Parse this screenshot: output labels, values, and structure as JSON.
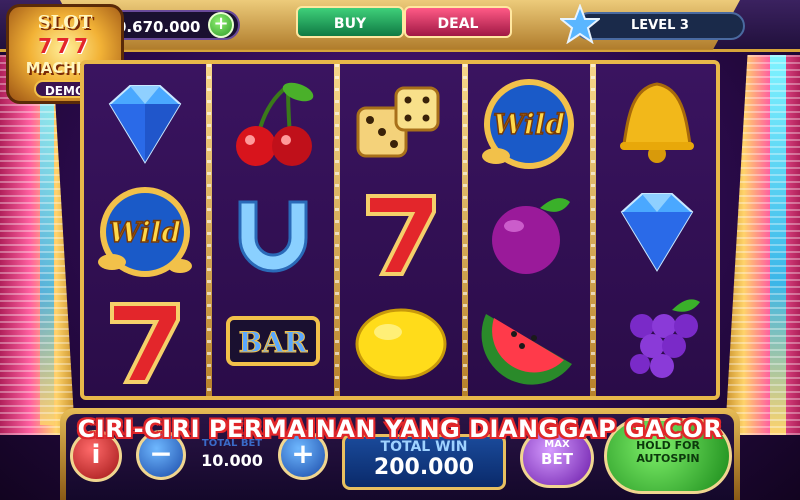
{
  "logo": {
    "line1": "SLOT",
    "line2": "777",
    "line3": "MACHINE",
    "badge": "DEMO"
  },
  "topbar": {
    "balance": "0.670.000",
    "add_button": "+",
    "tabs": [
      {
        "label": "BUY"
      },
      {
        "label": "DEAL"
      }
    ],
    "level": "LEVEL 3"
  },
  "reels": {
    "columns": [
      [
        "diamond-icon",
        "wild-icon",
        "seven-icon"
      ],
      [
        "cherries-icon",
        "horseshoe-icon",
        "bar-icon"
      ],
      [
        "dice-icon",
        "seven-icon",
        "lemon-icon"
      ],
      [
        "wild-icon",
        "plum-icon",
        "watermelon-icon"
      ],
      [
        "bell-icon",
        "diamond-icon",
        "grapes-icon"
      ]
    ],
    "wild_text": "Wild",
    "bar_text": "BAR"
  },
  "controls": {
    "info_label": "i",
    "minus_label": "−",
    "plus_label": "+",
    "total_bet_label": "TOTAL BET",
    "total_bet_value": "10.000",
    "total_win_label": "TOTAL WIN",
    "total_win_value": "200.000",
    "max_bet_top": "MAX",
    "max_bet_label": "BET",
    "hold_line1": "HOLD FOR",
    "hold_line2": "AUTOSPIN"
  },
  "caption": "CIRI-CIRI PERMAINAN YANG DIANGGAP GACOR",
  "colors": {
    "gold": "#e8b84a",
    "purple": "#2a0c48",
    "caption_outline": "#e0262a",
    "buy_tab": "#1fae5c",
    "deal_tab": "#d02a5a"
  }
}
